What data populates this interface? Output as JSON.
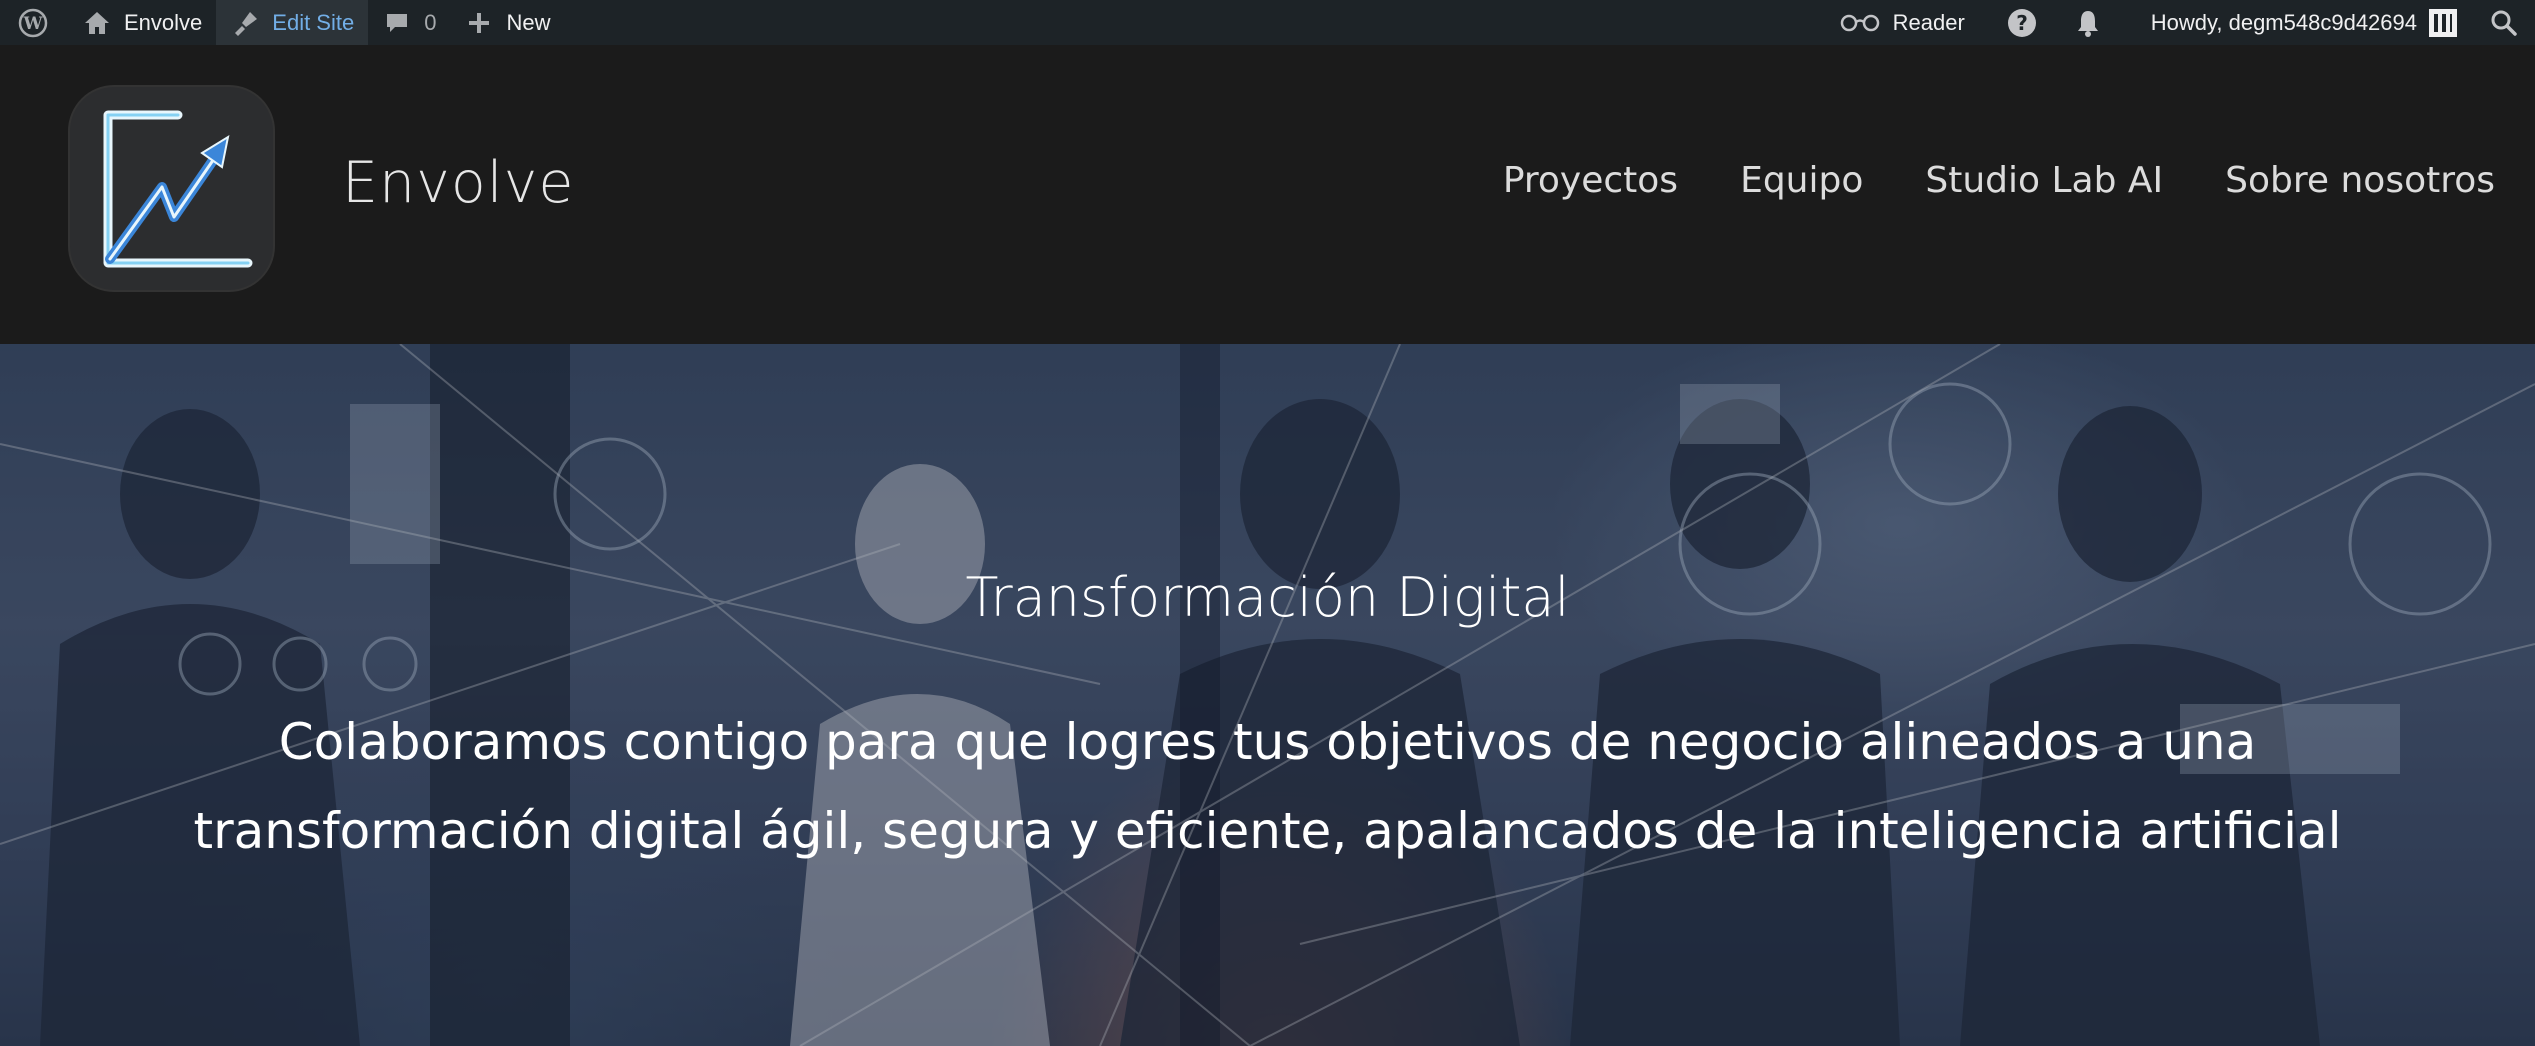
{
  "adminbar": {
    "site_name": "Envolve",
    "edit_site": "Edit Site",
    "comments_count": "0",
    "new_label": "New",
    "reader_label": "Reader",
    "howdy": "Howdy, degm548c9d42694",
    "icons": [
      "wordpress-icon",
      "home-icon",
      "brush-icon",
      "comment-icon",
      "plus-icon",
      "glasses-icon",
      "help-icon",
      "bell-icon",
      "avatar",
      "search-icon"
    ]
  },
  "header": {
    "site_title": "Envolve",
    "nav": [
      "Proyectos",
      "Equipo",
      "Studio Lab AI",
      "Sobre nosotros"
    ]
  },
  "hero": {
    "kicker": "Transformación Digital",
    "line1": "Colaboramos contigo para que logres tus objetivos de negocio alineados a una",
    "line2": "transformación digital ágil, segura y eficiente, apalancados de la inteligencia artificial"
  },
  "colors": {
    "adminbar_bg": "#1d2327",
    "adminbar_active": "#72aee6",
    "header_bg": "#1b1b1b",
    "logo_accent": "#5bc2f0"
  }
}
